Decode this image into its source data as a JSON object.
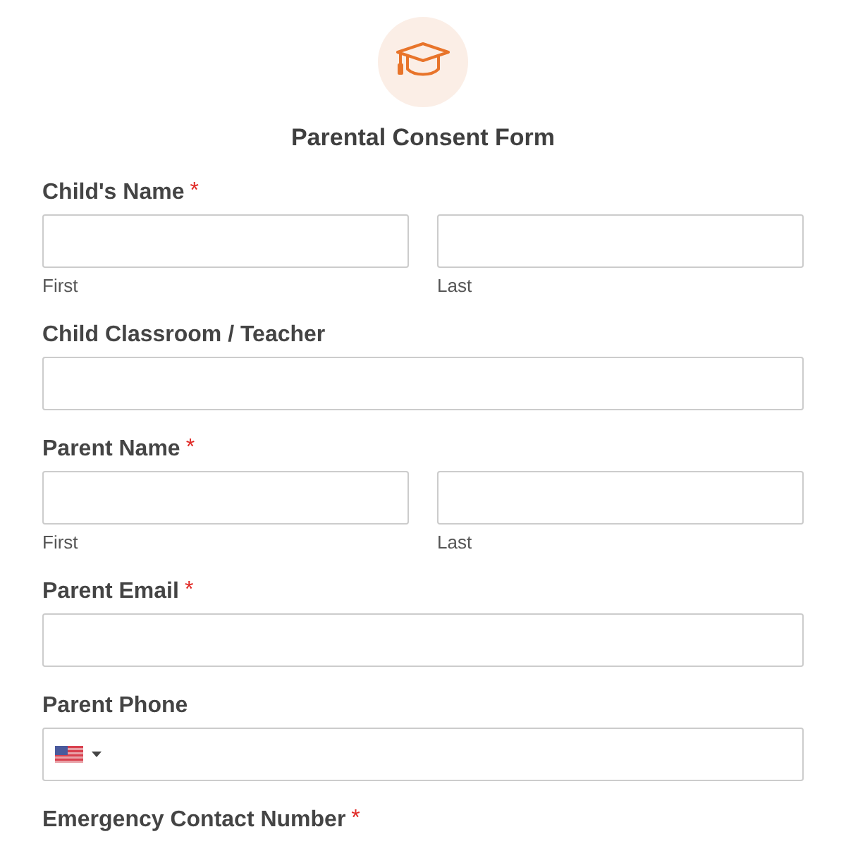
{
  "header": {
    "title": "Parental Consent Form"
  },
  "fields": [
    {
      "kind": "name",
      "label": "Child's Name",
      "required_mark": "*",
      "parts": [
        {
          "sublabel": "First"
        },
        {
          "sublabel": "Last"
        }
      ]
    },
    {
      "kind": "text",
      "label": "Child Classroom / Teacher"
    },
    {
      "kind": "name",
      "label": "Parent Name",
      "required_mark": "*",
      "parts": [
        {
          "sublabel": "First"
        },
        {
          "sublabel": "Last"
        }
      ]
    },
    {
      "kind": "email",
      "label": "Parent Email",
      "required_mark": "*"
    },
    {
      "kind": "phone",
      "label": "Parent Phone"
    },
    {
      "kind": "label",
      "label": "Emergency Contact Number",
      "required_mark": "*"
    }
  ]
}
